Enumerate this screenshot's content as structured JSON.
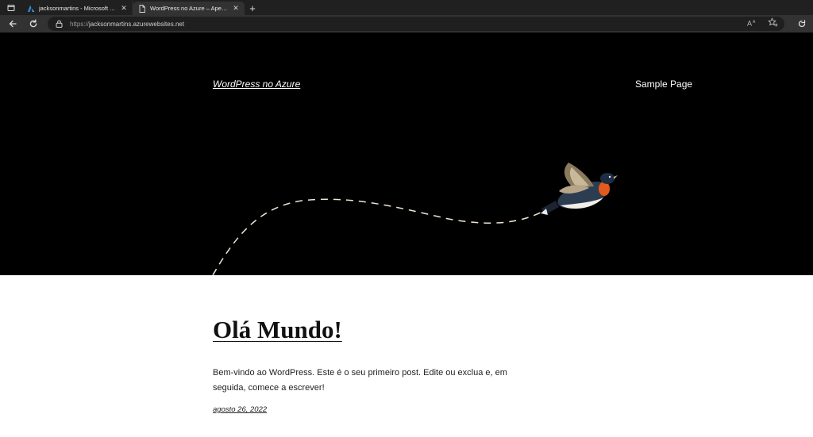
{
  "browser": {
    "tabs": [
      {
        "title": "jacksonmartins - Microsoft Azure",
        "icon": "azure-icon",
        "active": false
      },
      {
        "title": "WordPress no Azure – Apenas outro site WordPress",
        "icon": "page-icon",
        "active": true
      }
    ],
    "close_glyph": "✕",
    "new_tab_glyph": "+",
    "address": {
      "protocol": "https://",
      "host": "jacksonmartins.azurewebsites.net"
    },
    "toolbar_icons": [
      "back-arrow-icon",
      "refresh-icon",
      "read-aloud-icon",
      "favorites-star-icon",
      "extensions-icon"
    ]
  },
  "site": {
    "title": "WordPress no Azure",
    "nav": [
      {
        "label": "Sample Page"
      }
    ],
    "header_background": "#000000",
    "header_art": "bird-flight-path"
  },
  "post": {
    "title": "Olá Mundo!",
    "excerpt": "Bem-vindo ao WordPress. Este é o seu primeiro post. Edite ou exclua e, em seguida, comece a escrever!",
    "date": "agosto 26, 2022"
  }
}
